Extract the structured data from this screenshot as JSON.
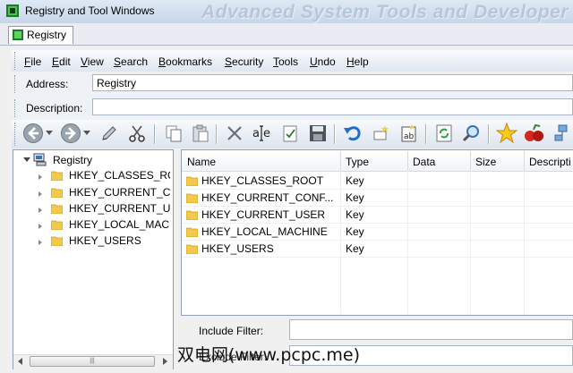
{
  "window": {
    "title": "Registry and Tool Windows",
    "banner": "Advanced System Tools and Developer G"
  },
  "doc_tab": {
    "label": "Registry"
  },
  "menu": [
    "File",
    "Edit",
    "View",
    "Search",
    "Bookmarks",
    "Security",
    "Tools",
    "Undo",
    "Help"
  ],
  "address": {
    "label": "Address:",
    "value": "Registry"
  },
  "description": {
    "label": "Description:",
    "value": ""
  },
  "toolbar_icons": [
    "back-icon",
    "dropdown-arrow-icon",
    "forward-icon",
    "dropdown-arrow-icon",
    "edit-icon",
    "cut-icon",
    "copy-icon",
    "paste-icon",
    "delete-icon",
    "rename-icon",
    "checkbox-icon",
    "save-icon",
    "undo-icon",
    "new-folder-icon",
    "new-value-icon",
    "refresh-icon",
    "search-icon",
    "favorites-star-icon",
    "tools-icon",
    "network-icon"
  ],
  "tree": {
    "root": "Registry",
    "items": [
      "HKEY_CLASSES_RO",
      "HKEY_CURRENT_C",
      "HKEY_CURRENT_U",
      "HKEY_LOCAL_MACH",
      "HKEY_USERS"
    ]
  },
  "list": {
    "columns": [
      "Name",
      "Type",
      "Data",
      "Size",
      "Descripti"
    ],
    "rows": [
      {
        "name": "HKEY_CLASSES_ROOT",
        "type": "Key"
      },
      {
        "name": "HKEY_CURRENT_CONF...",
        "type": "Key"
      },
      {
        "name": "HKEY_CURRENT_USER",
        "type": "Key"
      },
      {
        "name": "HKEY_LOCAL_MACHINE",
        "type": "Key"
      },
      {
        "name": "HKEY_USERS",
        "type": "Key"
      }
    ]
  },
  "filters": {
    "include_label": "Include Filter:",
    "exclude_label": "Exclude Filter:"
  },
  "watermark": "双电网(www.pcpc.me)",
  "colors": {
    "folder": "#f2c94c",
    "title_bar": "#c6d6ea",
    "accent_blue": "#1f6fd1"
  }
}
